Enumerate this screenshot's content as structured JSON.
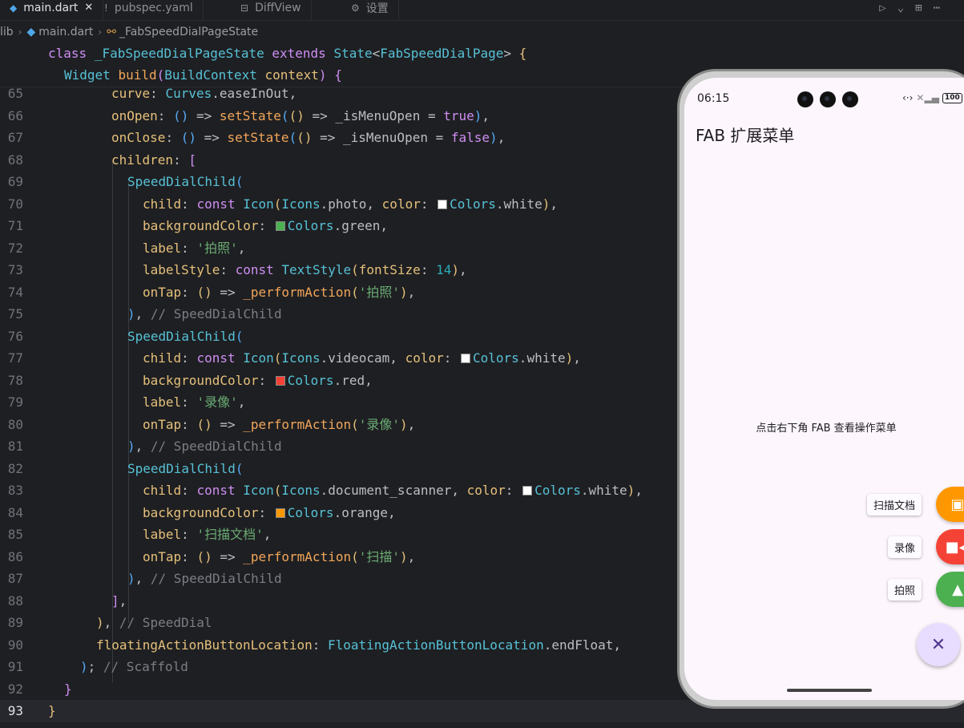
{
  "tabs": [
    {
      "label": "main.dart",
      "icon": "dart-file-icon",
      "close": "✕"
    },
    {
      "label": "pubspec.yaml",
      "icon": "yaml-file-icon"
    },
    {
      "label": "DiffView",
      "icon": "diff-icon"
    },
    {
      "label": "设置",
      "icon": "gear-icon"
    }
  ],
  "breadcrumb": [
    "lib",
    "main.dart",
    "_FabSpeedDialPageState"
  ],
  "sticky": {
    "line1": [
      "class",
      "_FabSpeedDialPageState",
      "extends",
      "State",
      "<",
      "FabSpeedDialPage",
      ">",
      "{"
    ],
    "line2": [
      "Widget",
      "build",
      "(",
      "BuildContext",
      "context",
      ")",
      "{"
    ]
  },
  "lines": [
    {
      "n": "65"
    },
    {
      "n": "66"
    },
    {
      "n": "67"
    },
    {
      "n": "68"
    },
    {
      "n": "69"
    },
    {
      "n": "70"
    },
    {
      "n": "71"
    },
    {
      "n": "72"
    },
    {
      "n": "73"
    },
    {
      "n": "74"
    },
    {
      "n": "75"
    },
    {
      "n": "76"
    },
    {
      "n": "77"
    },
    {
      "n": "78"
    },
    {
      "n": "79"
    },
    {
      "n": "80"
    },
    {
      "n": "81"
    },
    {
      "n": "82"
    },
    {
      "n": "83"
    },
    {
      "n": "84"
    },
    {
      "n": "85"
    },
    {
      "n": "86"
    },
    {
      "n": "87"
    },
    {
      "n": "88"
    },
    {
      "n": "89"
    },
    {
      "n": "90"
    },
    {
      "n": "91"
    },
    {
      "n": "92"
    },
    {
      "n": "93"
    }
  ],
  "colors": {
    "white": "#ffffff",
    "green": "#4caf50",
    "red": "#f44336",
    "orange": "#ff9800",
    "fab_bg": "#e9ddff"
  },
  "phone": {
    "time": "06:15",
    "battery": "100",
    "app_title": "FAB 扩展菜单",
    "hint": "点击右下角 FAB 查看操作菜单",
    "dial": [
      {
        "label": "扫描文档",
        "icon": "document-scanner-icon",
        "color": "#ff9800"
      },
      {
        "label": "录像",
        "icon": "videocam-icon",
        "color": "#f44336"
      },
      {
        "label": "拍照",
        "icon": "photo-icon",
        "color": "#4caf50"
      }
    ],
    "fab_icon": "close-icon"
  }
}
